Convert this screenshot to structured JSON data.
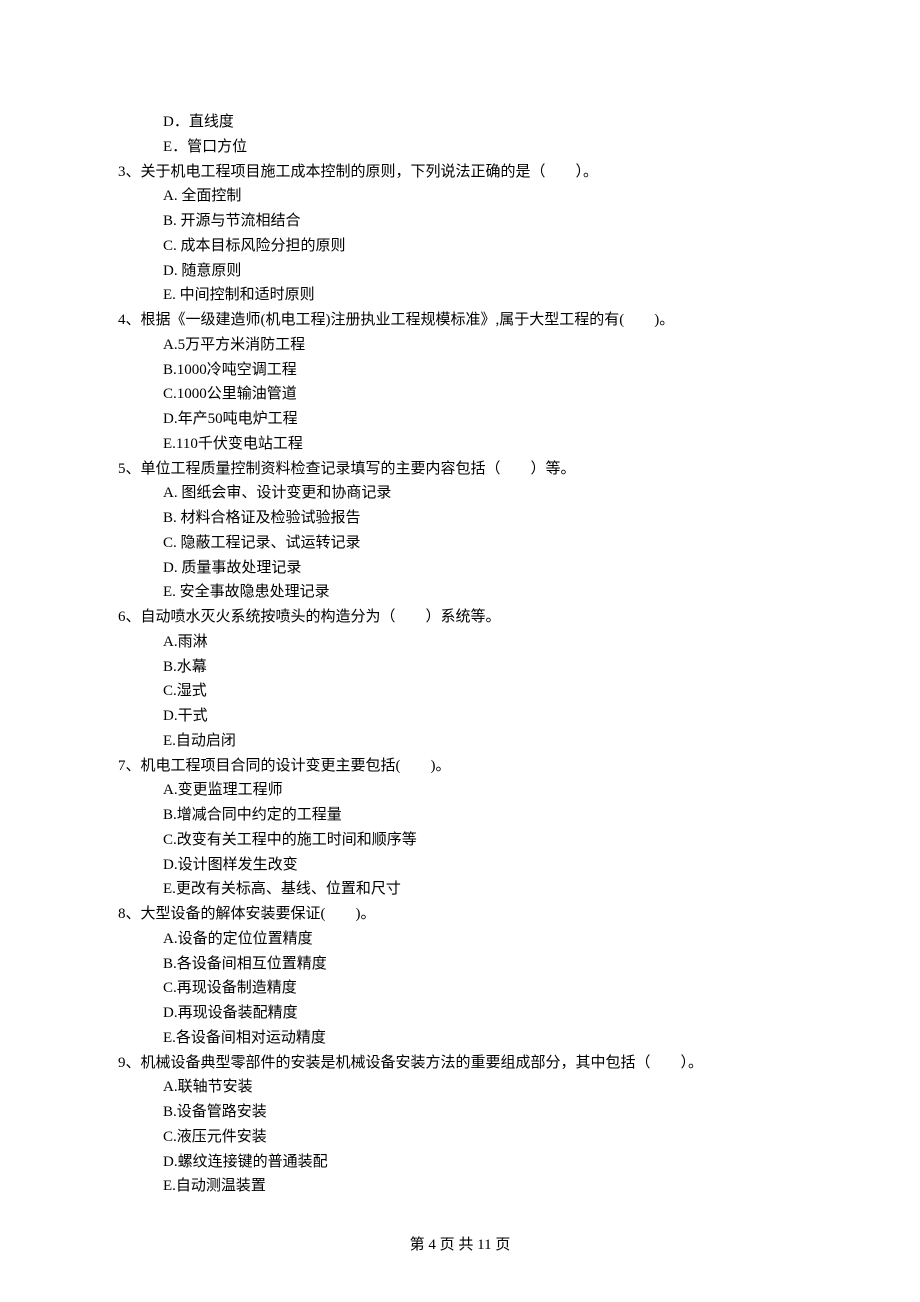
{
  "lead_options": {
    "d": "D．直线度",
    "e": "E．管口方位"
  },
  "q3": {
    "stem": "3、关于机电工程项目施工成本控制的原则，下列说法正确的是（　　）。",
    "a": "A. 全面控制",
    "b": "B. 开源与节流相结合",
    "c": "C. 成本目标风险分担的原则",
    "d": "D. 随意原则",
    "e": "E. 中间控制和适时原则"
  },
  "q4": {
    "stem": "4、根据《一级建造师(机电工程)注册执业工程规模标准》,属于大型工程的有(　　)。",
    "a": "A.5万平方米消防工程",
    "b": "B.1000冷吨空调工程",
    "c": "C.1000公里输油管道",
    "d": "D.年产50吨电炉工程",
    "e": "E.110千伏变电站工程"
  },
  "q5": {
    "stem": "5、单位工程质量控制资料检查记录填写的主要内容包括（　　）等。",
    "a": "A. 图纸会审、设计变更和协商记录",
    "b": "B. 材料合格证及检验试验报告",
    "c": "C. 隐蔽工程记录、试运转记录",
    "d": "D. 质量事故处理记录",
    "e": "E. 安全事故隐患处理记录"
  },
  "q6": {
    "stem": "6、自动喷水灭火系统按喷头的构造分为（　　）系统等。",
    "a": "A.雨淋",
    "b": "B.水幕",
    "c": "C.湿式",
    "d": "D.干式",
    "e": "E.自动启闭"
  },
  "q7": {
    "stem": "7、机电工程项目合同的设计变更主要包括(　　)。",
    "a": "A.变更监理工程师",
    "b": "B.增减合同中约定的工程量",
    "c": "C.改变有关工程中的施工时间和顺序等",
    "d": "D.设计图样发生改变",
    "e": "E.更改有关标高、基线、位置和尺寸"
  },
  "q8": {
    "stem": "8、大型设备的解体安装要保证(　　)。",
    "a": "A.设备的定位位置精度",
    "b": "B.各设备间相互位置精度",
    "c": "C.再现设备制造精度",
    "d": "D.再现设备装配精度",
    "e": "E.各设备间相对运动精度"
  },
  "q9": {
    "stem": "9、机械设备典型零部件的安装是机械设备安装方法的重要组成部分，其中包括（　　）。",
    "a": "A.联轴节安装",
    "b": "B.设备管路安装",
    "c": "C.液压元件安装",
    "d": "D.螺纹连接键的普通装配",
    "e": "E.自动测温装置"
  },
  "footer": "第 4 页 共 11 页"
}
